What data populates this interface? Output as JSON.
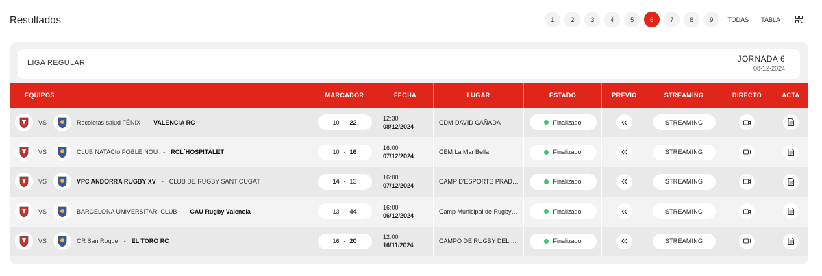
{
  "page": {
    "title": "Resultados"
  },
  "pager": {
    "pages": [
      "1",
      "2",
      "3",
      "4",
      "5",
      "6",
      "7",
      "8",
      "9"
    ],
    "active": "6",
    "todas": "TODAS",
    "tabla": "TABLA",
    "qr_icon": "qr-code-icon",
    "accent": "#e0261a"
  },
  "liga": {
    "name": "LIGA REGULAR",
    "jornada": "JORNADA 6",
    "date": "08-12-2024"
  },
  "table": {
    "headers": [
      "EQUIPOS",
      "MARCADOR",
      "FECHA",
      "LUGAR",
      "ESTADO",
      "PREVIO",
      "STREAMING",
      "DIRECTO",
      "ACTA"
    ],
    "vs_label": "VS",
    "rows": [
      {
        "home": "Recoletas salud FÉNIX",
        "away": "VALENCIA RC",
        "winner": "away",
        "home_score": "10",
        "away_score": "22",
        "time": "12:30",
        "date": "08/12/2024",
        "venue": "CDM DAVID CAÑADA",
        "status": "Finalizado",
        "stream": "STREAMING"
      },
      {
        "home": "CLUB NATACIó POBLE NOU",
        "away": "RCL´HOSPITALET",
        "winner": "away",
        "home_score": "10",
        "away_score": "16",
        "time": "16:00",
        "date": "07/12/2024",
        "venue": "CEM La Mar Bella",
        "status": "Finalizado",
        "stream": "STREAMING"
      },
      {
        "home": "VPC ANDORRA RUGBY XV",
        "away": "CLUB DE RUGBY SANT CUGAT",
        "winner": "home",
        "home_score": "14",
        "away_score": "13",
        "time": "16:00",
        "date": "07/12/2024",
        "venue": "CAMP D'ESPORTS PRADA DE MORANT",
        "status": "Finalizado",
        "stream": "STREAMING"
      },
      {
        "home": "BARCELONA UNIVERSITARI CLUB",
        "away": "CAU Rugby Valencia",
        "winner": "away",
        "home_score": "13",
        "away_score": "44",
        "time": "16:00",
        "date": "06/12/2024",
        "venue": "Camp Municipal de Rugby de la Foixarda",
        "status": "Finalizado",
        "stream": "STREAMING"
      },
      {
        "home": "CR San Roque",
        "away": "EL TORO RC",
        "winner": "away",
        "home_score": "16",
        "away_score": "20",
        "time": "12:00",
        "date": "16/11/2024",
        "venue": "CAMPO DE RUGBY DEL RIO MONTAÑA",
        "status": "Finalizado",
        "stream": "STREAMING"
      }
    ],
    "icons": {
      "previo": "rewind-icon",
      "directo": "video-camera-icon",
      "acta": "document-icon"
    },
    "status_color": "#3cc66b"
  }
}
